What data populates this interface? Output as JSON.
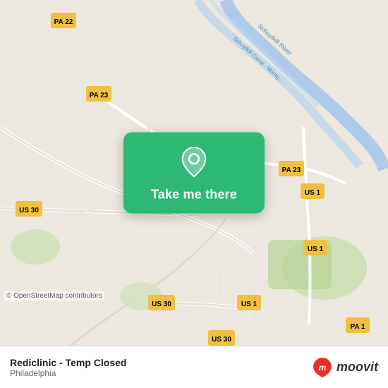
{
  "map": {
    "copyright": "© OpenStreetMap contributors"
  },
  "action_card": {
    "label": "Take me there",
    "pin_icon": "location-pin-icon"
  },
  "bottom_bar": {
    "location_name": "Rediclinic - Temp Closed",
    "location_city": "Philadelphia",
    "moovit_label": "moovit"
  }
}
